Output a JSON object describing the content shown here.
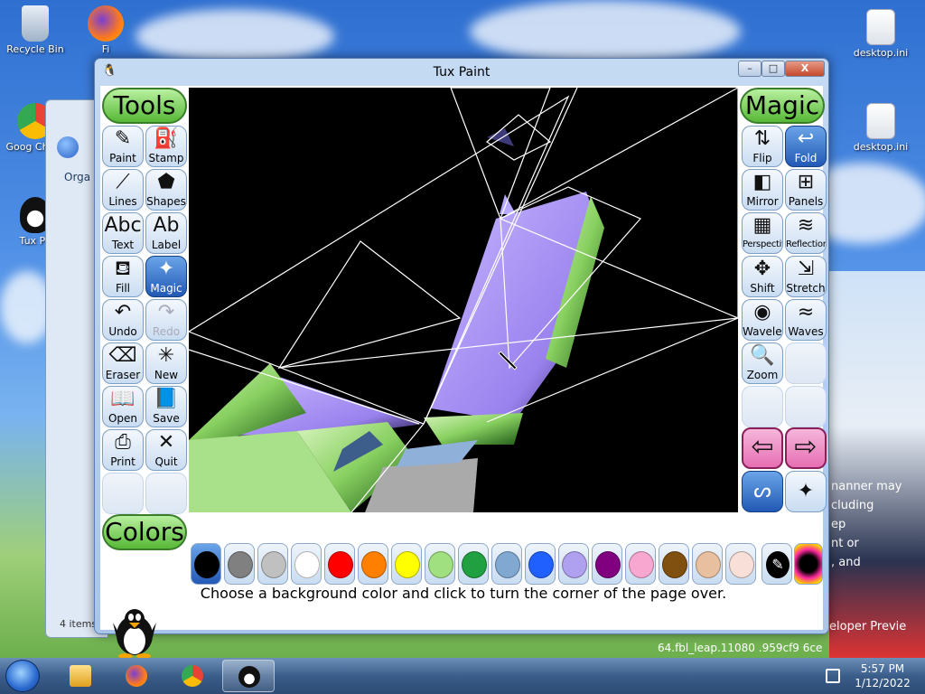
{
  "desktop": {
    "icons": [
      {
        "label": "Recycle Bin",
        "icon": "recycle-bin-icon"
      },
      {
        "label": "Fi",
        "icon": "firefox-icon"
      },
      {
        "label": "Goog Chron",
        "icon": "chrome-icon"
      },
      {
        "label": "Tux Pa",
        "icon": "tux-icon"
      },
      {
        "label": "desktop.ini",
        "icon": "settings-file-icon"
      },
      {
        "label": "desktop.ini",
        "icon": "settings-file-icon"
      }
    ],
    "wallpaper_text": [
      "nanner may",
      "cluding",
      "ep",
      "nt or",
      ", and",
      "eloper Previe",
      "64.fbl_leap.11080 .959cf9 6ce"
    ]
  },
  "explorer": {
    "organize_label": "Orga",
    "items_label": "4 items"
  },
  "window": {
    "title": "Tux Paint",
    "controls": {
      "minimize": "–",
      "maximize": "□",
      "close": "X"
    }
  },
  "tools": {
    "header": "Tools",
    "items": [
      {
        "label": "Paint",
        "icon": "paintbrush-icon",
        "glyph": "✎"
      },
      {
        "label": "Stamp",
        "icon": "stamp-icon",
        "glyph": "⛽"
      },
      {
        "label": "Lines",
        "icon": "lines-icon",
        "glyph": "⟋"
      },
      {
        "label": "Shapes",
        "icon": "pentagon-icon",
        "glyph": "⬟"
      },
      {
        "label": "Text",
        "icon": "text-abc-icon",
        "glyph": "Abc"
      },
      {
        "label": "Label",
        "icon": "label-ab-icon",
        "glyph": "Ab"
      },
      {
        "label": "Fill",
        "icon": "paint-bucket-icon",
        "glyph": "⛾"
      },
      {
        "label": "Magic",
        "icon": "magic-wand-icon",
        "glyph": "✦"
      },
      {
        "label": "Undo",
        "icon": "undo-icon",
        "glyph": "↶"
      },
      {
        "label": "Redo",
        "icon": "redo-icon",
        "glyph": "↷"
      },
      {
        "label": "Eraser",
        "icon": "eraser-icon",
        "glyph": "⌫"
      },
      {
        "label": "New",
        "icon": "new-page-icon",
        "glyph": "✳"
      },
      {
        "label": "Open",
        "icon": "open-book-icon",
        "glyph": "📖"
      },
      {
        "label": "Save",
        "icon": "save-book-icon",
        "glyph": "📘"
      },
      {
        "label": "Print",
        "icon": "printer-icon",
        "glyph": "⎙"
      },
      {
        "label": "Quit",
        "icon": "quit-x-icon",
        "glyph": "✕"
      }
    ],
    "selected": "Magic",
    "disabled": "Redo"
  },
  "magic": {
    "header": "Magic",
    "items": [
      {
        "label": "Flip",
        "icon": "flip-arrows-icon",
        "glyph": "⇅"
      },
      {
        "label": "Fold",
        "icon": "fold-icon",
        "glyph": "↩"
      },
      {
        "label": "Mirror",
        "icon": "mirror-icon",
        "glyph": "◧"
      },
      {
        "label": "Panels",
        "icon": "panels-icon",
        "glyph": "⊞"
      },
      {
        "label": "Perspective",
        "icon": "perspective-icon",
        "glyph": "▦"
      },
      {
        "label": "Reflection",
        "icon": "reflection-icon",
        "glyph": "≋"
      },
      {
        "label": "Shift",
        "icon": "shift-arrows-icon",
        "glyph": "✥"
      },
      {
        "label": "Stretch",
        "icon": "stretch-icon",
        "glyph": "⇲"
      },
      {
        "label": "Wavelets",
        "icon": "wavelets-icon",
        "glyph": "◉"
      },
      {
        "label": "Waves",
        "icon": "waves-icon",
        "glyph": "≈"
      },
      {
        "label": "Zoom",
        "icon": "zoom-icon",
        "glyph": "🔍"
      }
    ],
    "selected": "Fold"
  },
  "colors": {
    "header": "Colors",
    "swatches": [
      "#000000",
      "#808080",
      "#c0c0c0",
      "#ffffff",
      "#ff0000",
      "#ff8000",
      "#ffff00",
      "#a0e080",
      "#20a040",
      "#80a8d0",
      "#2060ff",
      "#b0a0f0",
      "#800080",
      "#f8a8d0",
      "#805010",
      "#e8c0a0",
      "#f8e0d8"
    ],
    "selected": "#000000"
  },
  "status": {
    "message": "Choose a background color and click to turn the corner of the page over."
  },
  "taskbar": {
    "apps": [
      "explorer-icon",
      "firefox-icon",
      "chrome-icon",
      "tux-icon"
    ],
    "time": "5:57 PM",
    "date": "1/12/2022"
  }
}
